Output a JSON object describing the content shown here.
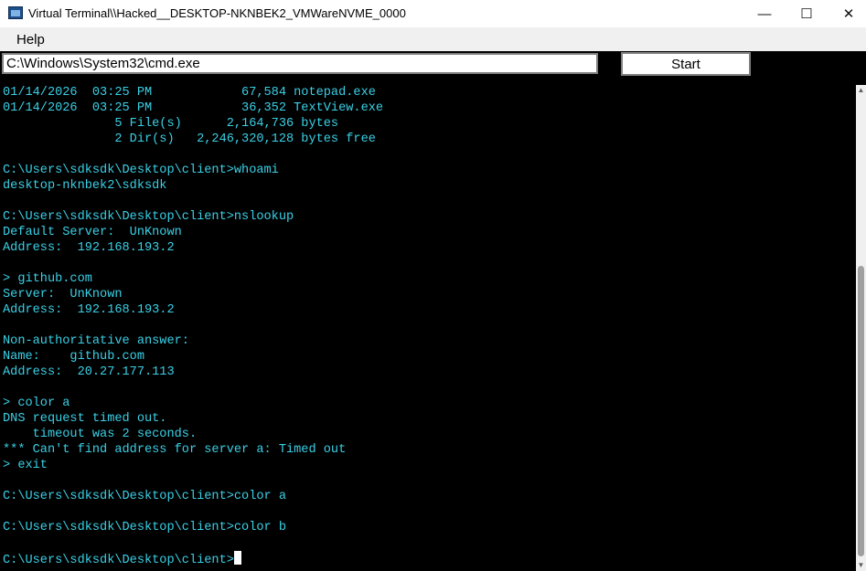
{
  "window": {
    "title": "Virtual Terminal\\\\Hacked__DESKTOP-NKNBEK2_VMWareNVME_0000",
    "icons": {
      "app": "terminal-app-icon",
      "minimize": "minimize-icon",
      "maximize": "maximize-icon",
      "close": "close-icon"
    },
    "glyphs": {
      "minimize": "—",
      "maximize": "☐",
      "close": "✕"
    }
  },
  "menu": {
    "help": "Help"
  },
  "toolbar": {
    "command_value": "C:\\Windows\\System32\\cmd.exe",
    "start_label": "Start"
  },
  "terminal": {
    "text_color": "#3ad0e6",
    "background": "#000000",
    "lines": [
      "01/14/2026  03:25 PM            67,584 notepad.exe",
      "01/14/2026  03:25 PM            36,352 TextView.exe",
      "               5 File(s)      2,164,736 bytes",
      "               2 Dir(s)   2,246,320,128 bytes free",
      "",
      "C:\\Users\\sdksdk\\Desktop\\client>whoami",
      "desktop-nknbek2\\sdksdk",
      "",
      "C:\\Users\\sdksdk\\Desktop\\client>nslookup",
      "Default Server:  UnKnown",
      "Address:  192.168.193.2",
      "",
      "> github.com",
      "Server:  UnKnown",
      "Address:  192.168.193.2",
      "",
      "Non-authoritative answer:",
      "Name:    github.com",
      "Address:  20.27.177.113",
      "",
      "> color a",
      "DNS request timed out.",
      "    timeout was 2 seconds.",
      "*** Can't find address for server a: Timed out",
      "> exit",
      "",
      "C:\\Users\\sdksdk\\Desktop\\client>color a",
      "",
      "C:\\Users\\sdksdk\\Desktop\\client>color b",
      "",
      "C:\\Users\\sdksdk\\Desktop\\client>"
    ]
  },
  "scrollbar": {
    "up_glyph": "▲",
    "down_glyph": "▼"
  }
}
